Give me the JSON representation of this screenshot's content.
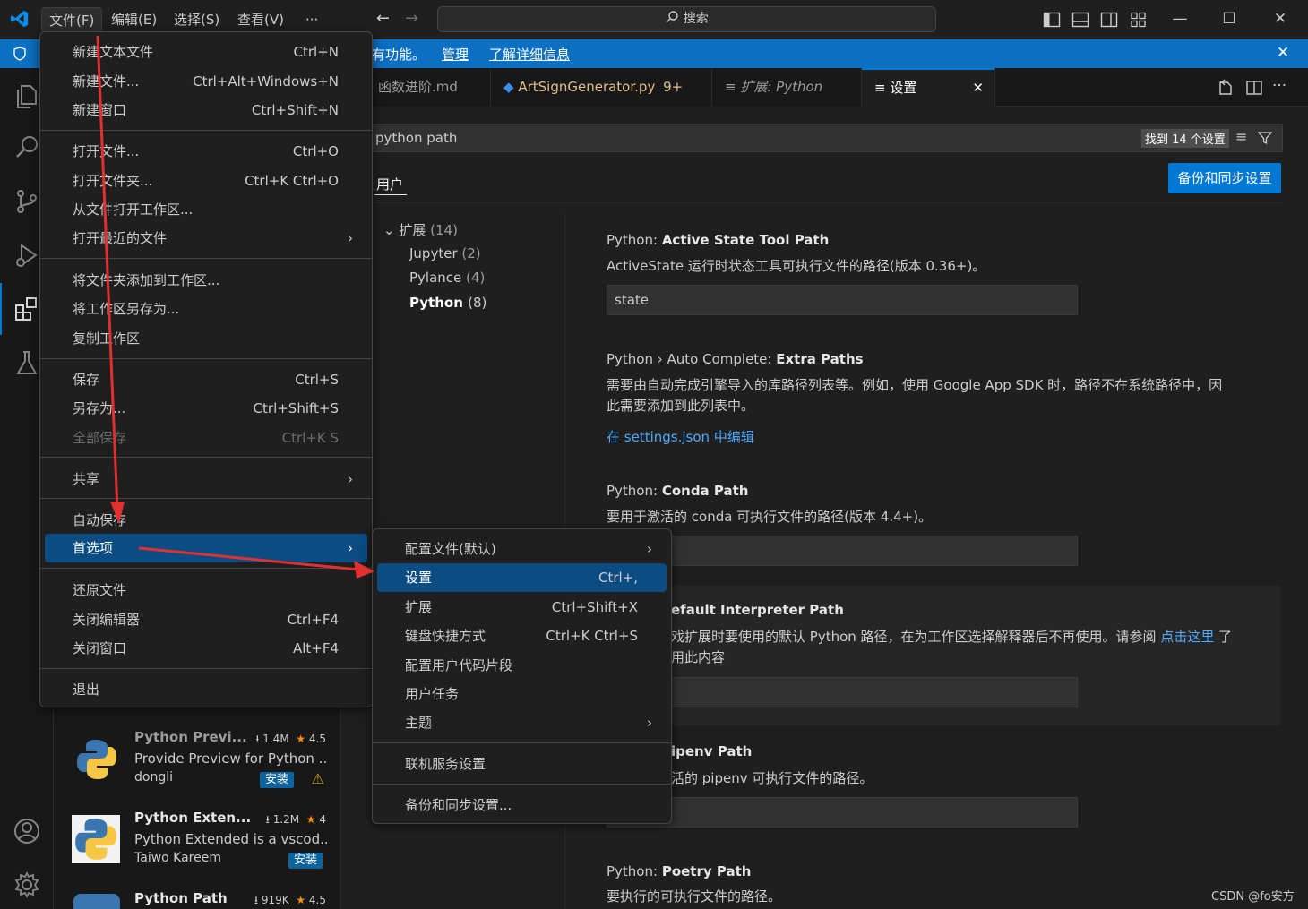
{
  "titlebar": {
    "menus": [
      "文件(F)",
      "编辑(E)",
      "选择(S)",
      "查看(V)",
      "···"
    ],
    "search_placeholder": "搜索",
    "back_icon": "arrow-left-icon",
    "forward_icon": "arrow-right-icon"
  },
  "notification": {
    "text": "有功能。",
    "manage": "管理",
    "learn_more": "了解详细信息"
  },
  "tabs": [
    {
      "label": "函数进阶.md"
    },
    {
      "label": "ArtSignGenerator.py",
      "badge": "9+"
    },
    {
      "label": "扩展: Python"
    },
    {
      "label": "设置"
    }
  ],
  "settings": {
    "search_value": "python path",
    "found_badge": "找到 14 个设置",
    "scope_tab": "用户",
    "sync_button": "备份和同步设置",
    "tree": {
      "group": "扩展",
      "group_count": "(14)",
      "items": [
        {
          "name": "Jupyter",
          "count": "(2)"
        },
        {
          "name": "Pylance",
          "count": "(4)"
        },
        {
          "name": "Python",
          "count": "(8)"
        }
      ]
    },
    "items": [
      {
        "prefix": "Python: ",
        "name": "Active State Tool Path",
        "desc": "ActiveState 运行时状态工具可执行文件的路径(版本 0.36+)。",
        "value": "state"
      },
      {
        "prefix": "Python › Auto Complete: ",
        "name": "Extra Paths",
        "desc1": "需要由自动完成引擎导入的库路径列表等。例如，使用 Google App SDK 时，路径不在系统路径中，因",
        "desc2": "此需要添加到此列表中。",
        "link": "在 settings.json 中编辑"
      },
      {
        "prefix": "Python: ",
        "name": "Conda Path",
        "desc": "要用于激活的 conda 可执行文件的路径(版本 4.4+)。"
      },
      {
        "name": "efault Interpreter Path",
        "desc1": "戏扩展时要使用的默认 Python 路径，在为工作区选择解释器后不再使用。请参阅 ",
        "desc_link": "点击这里",
        "desc1_tail": " 了",
        "desc2": "用此内容"
      },
      {
        "name": "ipenv Path",
        "desc": "活的 pipenv 可执行文件的路径。"
      },
      {
        "prefix": "Python: ",
        "name": "Poetry Path",
        "desc": "要执行的可执行文件的路径。"
      }
    ]
  },
  "file_menu": {
    "items": [
      {
        "label": "新建文本文件",
        "kb": "Ctrl+N"
      },
      {
        "label": "新建文件...",
        "kb": "Ctrl+Alt+Windows+N"
      },
      {
        "label": "新建窗口",
        "kb": "Ctrl+Shift+N"
      },
      {
        "label": "打开文件...",
        "kb": "Ctrl+O"
      },
      {
        "label": "打开文件夹...",
        "kb": "Ctrl+K Ctrl+O"
      },
      {
        "label": "从文件打开工作区...",
        "kb": ""
      },
      {
        "label": "打开最近的文件",
        "kb": ""
      },
      {
        "label": "将文件夹添加到工作区...",
        "kb": ""
      },
      {
        "label": "将工作区另存为...",
        "kb": ""
      },
      {
        "label": "复制工作区",
        "kb": ""
      },
      {
        "label": "保存",
        "kb": "Ctrl+S"
      },
      {
        "label": "另存为...",
        "kb": "Ctrl+Shift+S"
      },
      {
        "label": "全部保存",
        "kb": "Ctrl+K S"
      },
      {
        "label": "共享",
        "kb": ""
      },
      {
        "label": "自动保存",
        "kb": ""
      },
      {
        "label": "首选项",
        "kb": ""
      },
      {
        "label": "还原文件",
        "kb": ""
      },
      {
        "label": "关闭编辑器",
        "kb": "Ctrl+F4"
      },
      {
        "label": "关闭窗口",
        "kb": "Alt+F4"
      },
      {
        "label": "退出",
        "kb": ""
      }
    ]
  },
  "pref_menu": {
    "items": [
      {
        "label": "配置文件(默认)",
        "kb": ""
      },
      {
        "label": "设置",
        "kb": "Ctrl+,"
      },
      {
        "label": "扩展",
        "kb": "Ctrl+Shift+X"
      },
      {
        "label": "键盘快捷方式",
        "kb": "Ctrl+K Ctrl+S"
      },
      {
        "label": "配置用户代码片段",
        "kb": ""
      },
      {
        "label": "用户任务",
        "kb": ""
      },
      {
        "label": "主题",
        "kb": ""
      },
      {
        "label": "联机服务设置",
        "kb": ""
      },
      {
        "label": "备份和同步设置...",
        "kb": ""
      }
    ]
  },
  "extensions": [
    {
      "name": "Python Previ...",
      "downloads": "1.4M",
      "rating": "4.5",
      "desc": "Provide Preview for Python ...",
      "publisher": "dongli",
      "install": "安装"
    },
    {
      "name": "Python Exten...",
      "downloads": "1.2M",
      "rating": "4",
      "desc": "Python Extended is a vscod...",
      "publisher": "Taiwo Kareem",
      "install": "安装"
    },
    {
      "name": "Python Path",
      "downloads": "919K",
      "rating": "4.5"
    }
  ],
  "watermark": "CSDN @fo安方",
  "colors": {
    "accent": "#0078d4",
    "notification": "#0b6fc2",
    "highlight": "#0b4c82",
    "arrow": "#e03030",
    "link": "#4daafc"
  }
}
